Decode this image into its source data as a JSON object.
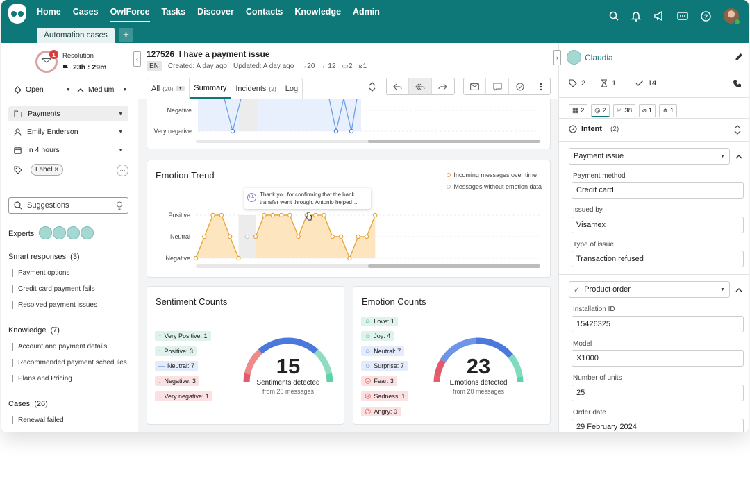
{
  "nav": {
    "items": [
      "Home",
      "Cases",
      "OwlForce",
      "Tasks",
      "Discover",
      "Contacts",
      "Knowledge",
      "Admin"
    ],
    "active": "OwlForce"
  },
  "tabs": {
    "automation": "Automation cases",
    "add": "+"
  },
  "left": {
    "sla": {
      "badge": "1",
      "label": "Resolution",
      "time": "23h : 29m"
    },
    "status": "Open",
    "priority": "Medium",
    "category": "Payments",
    "assignee": "Emily Enderson",
    "due": "In 4 hours",
    "label_tag": "Label",
    "more": "···",
    "suggestions": "Suggestions",
    "experts": "Experts",
    "smart": {
      "title": "Smart responses",
      "count": "(3)",
      "items": [
        "Payment options",
        "Credit card payment fails",
        "Resolved payment issues"
      ]
    },
    "knowledge": {
      "title": "Knowledge",
      "count": "(7)",
      "items": [
        "Account and payment details",
        "Recommended payment schedules",
        "Plans and Pricing"
      ]
    },
    "cases": {
      "title": "Cases",
      "count": "(26)",
      "items": [
        "Renewal failed"
      ]
    }
  },
  "header": {
    "case_id": "127526",
    "title": "I have a payment issue",
    "lang": "EN",
    "created": "Created: A day ago",
    "updated": "Updated: A day ago",
    "out": "20",
    "in": "12",
    "comments": "2",
    "attachments": "1"
  },
  "tabs_main": {
    "all": "All",
    "all_count": "(20)",
    "summary": "Summary",
    "incidents": "Incidents",
    "incidents_count": "(2)",
    "log": "Log"
  },
  "sentiment_top": {
    "labels": [
      "Negative",
      "Very negative"
    ]
  },
  "emotion_trend": {
    "title": "Emotion Trend",
    "legend": [
      "Incoming messages over time",
      "Messages without emotion data"
    ],
    "tooltip_initials": "KL",
    "tooltip_text": "Thank you for confirming that the bank transfer went through. Antonio helped…",
    "levels": [
      "Positive",
      "Neutral",
      "Negative"
    ]
  },
  "chart_data": [
    {
      "type": "line",
      "title": "Emotion Trend",
      "levels": [
        "Negative",
        "Neutral",
        "Positive"
      ],
      "values": [
        0,
        1,
        2,
        2,
        1,
        0,
        null,
        1,
        2,
        2,
        2,
        2,
        1,
        2,
        2,
        2,
        1,
        1,
        0,
        1,
        1,
        2
      ]
    },
    {
      "type": "bar",
      "title": "Sentiment Counts",
      "categories": [
        "Very Positive",
        "Positive",
        "Neutral",
        "Negative",
        "Very negative"
      ],
      "values": [
        1,
        3,
        7,
        3,
        1
      ],
      "total": 15,
      "center_label": "Sentiments detected",
      "sub_label": "from 20 messages"
    },
    {
      "type": "bar",
      "title": "Emotion Counts",
      "categories": [
        "Love",
        "Joy",
        "Neutral",
        "Surprise",
        "Fear",
        "Sadness",
        "Angry"
      ],
      "values": [
        1,
        4,
        7,
        7,
        3,
        1,
        0
      ],
      "total": 23,
      "center_label": "Emotions detected",
      "sub_label": "from 20 messages"
    }
  ],
  "sentiment": {
    "title": "Sentiment Counts",
    "rows": [
      "Very Positive: 1",
      "Positive: 3",
      "Neutral: 7",
      "Negative: 3",
      "Very negative: 1"
    ],
    "total": "15",
    "label": "Sentiments detected",
    "sub": "from 20 messages"
  },
  "emotion": {
    "title": "Emotion Counts",
    "rows": [
      "Love: 1",
      "Joy: 4",
      "Neutral: 7",
      "Surprise: 7",
      "Fear: 3",
      "Sadness: 1",
      "Angry: 0"
    ],
    "total": "23",
    "label": "Emotions detected",
    "sub": "from 20 messages"
  },
  "right": {
    "contact": "Claudia",
    "stats": [
      "2",
      "1",
      "14"
    ],
    "tabs": [
      "2",
      "2",
      "38",
      "1",
      "1"
    ],
    "intent": {
      "title": "Intent",
      "count": "(2)"
    },
    "payment": {
      "dropdown": "Payment issue",
      "fields": [
        {
          "label": "Payment method",
          "value": "Credit card"
        },
        {
          "label": "Issued by",
          "value": "Visamex"
        },
        {
          "label": "Type of issue",
          "value": "Transaction refused"
        }
      ]
    },
    "order": {
      "dropdown": "Product order",
      "fields": [
        {
          "label": "Installation ID",
          "value": "15426325"
        },
        {
          "label": "Model",
          "value": "X1000"
        },
        {
          "label": "Number of units",
          "value": "25"
        },
        {
          "label": "Order date",
          "value": "29 February 2024"
        }
      ]
    }
  },
  "colors": {
    "teal": "#0e7778",
    "positive": "#dff3ec",
    "neutral": "#e4ecfb",
    "negative": "#fbe1e1"
  }
}
